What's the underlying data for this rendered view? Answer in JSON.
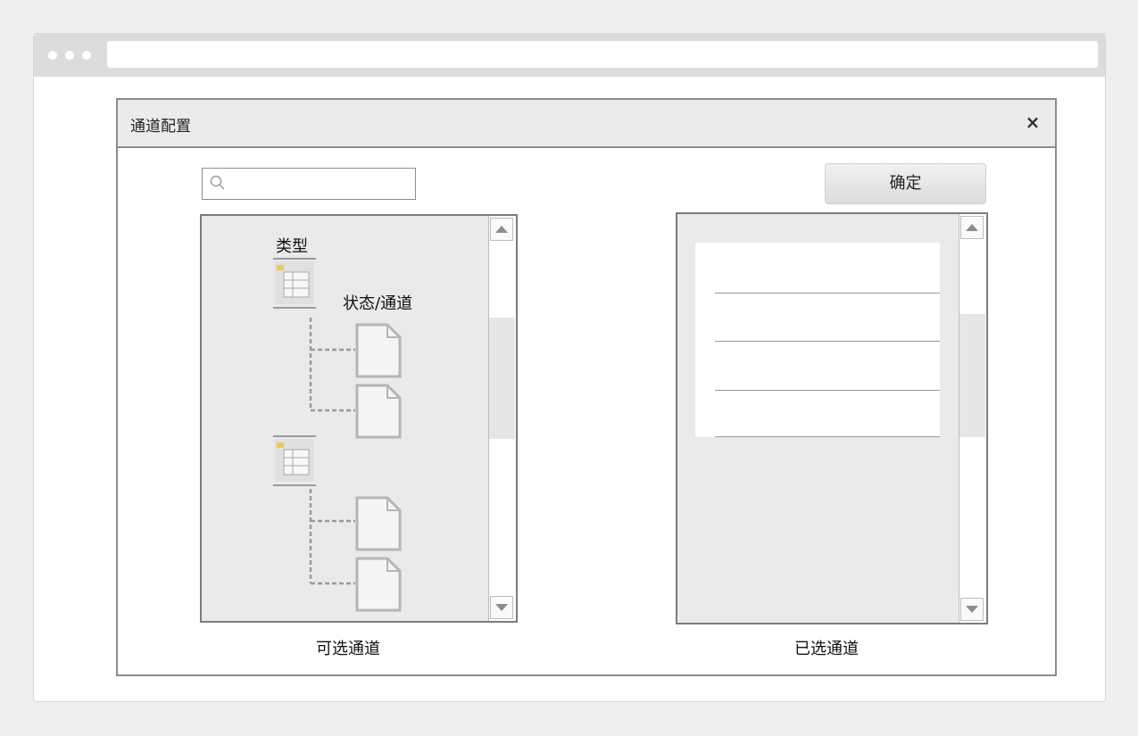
{
  "browser": {
    "dots": [
      "•",
      "•",
      "•"
    ]
  },
  "dialog": {
    "title": "通道配置",
    "close_icon": "close-icon",
    "search": {
      "value": "",
      "placeholder": "",
      "icon": "search-icon"
    },
    "confirm_label": "确定",
    "available_panel": {
      "caption": "可选通道",
      "tree": {
        "type_label": "类型",
        "status_label": "状态/通道",
        "groups": [
          {
            "icon": "folder-list-icon",
            "children": [
              {
                "icon": "document-icon"
              },
              {
                "icon": "document-icon"
              }
            ]
          },
          {
            "icon": "folder-list-icon",
            "children": [
              {
                "icon": "document-icon"
              },
              {
                "icon": "document-icon"
              }
            ]
          }
        ]
      }
    },
    "selected_panel": {
      "caption": "已选通道",
      "items": [
        "",
        "",
        "",
        ""
      ]
    }
  }
}
